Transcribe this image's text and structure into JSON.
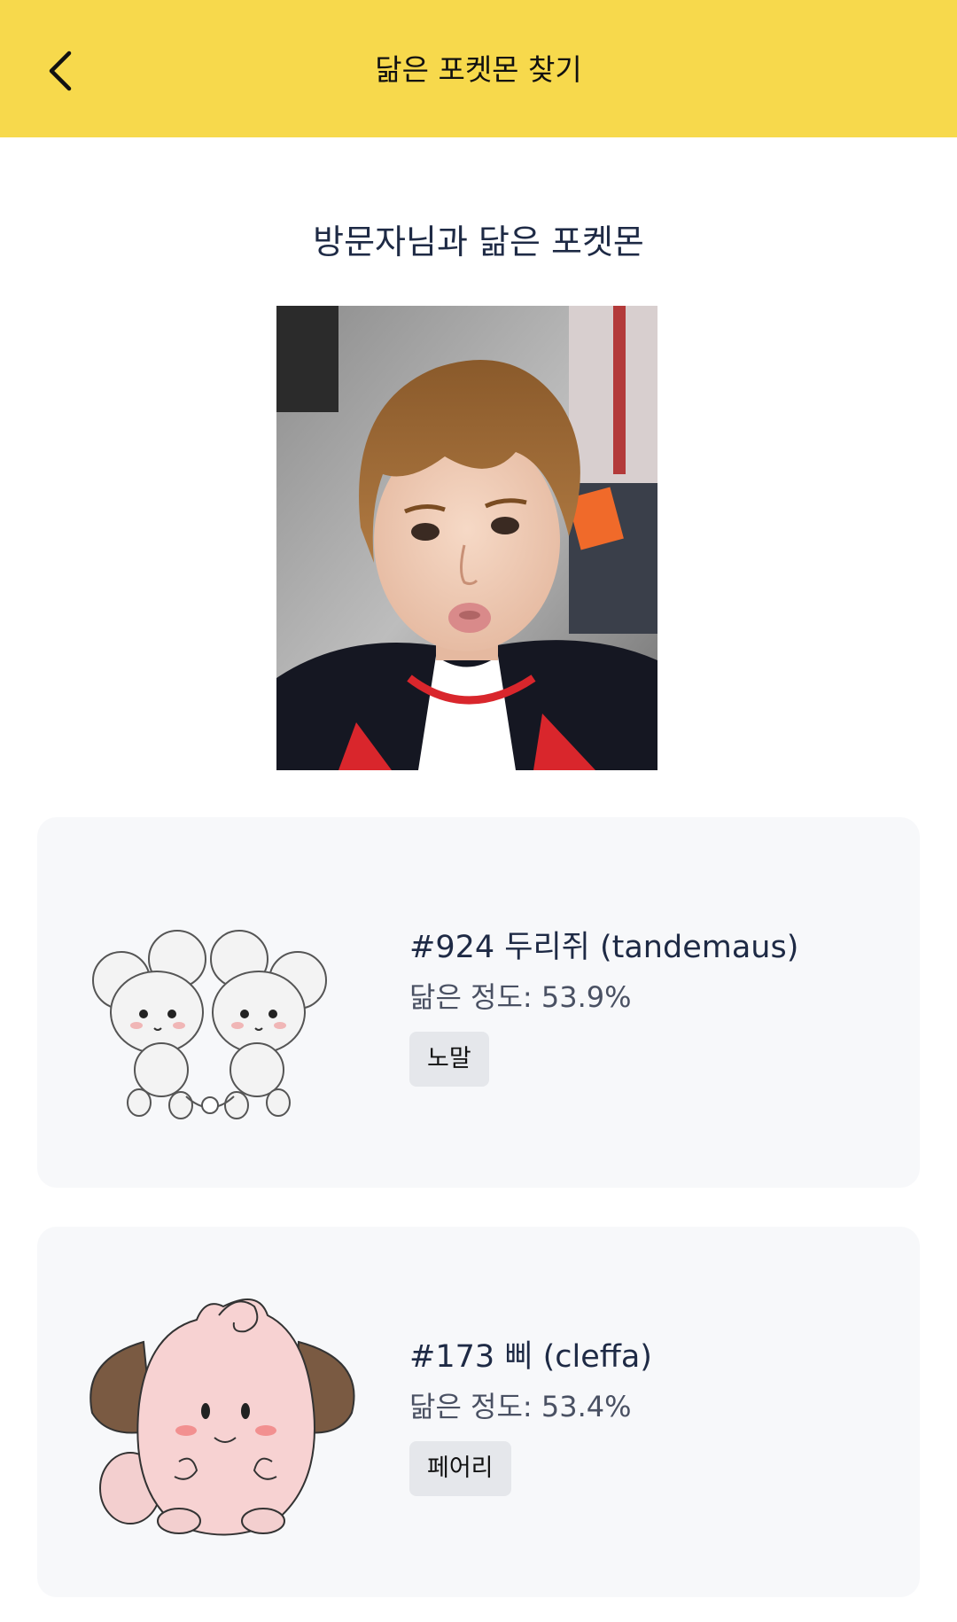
{
  "header": {
    "title": "닮은 포켓몬 찾기",
    "back_icon": "chevron-left-icon",
    "background": "#f7d94c"
  },
  "main": {
    "section_title": "방문자님과 닮은 포켓몬"
  },
  "results": [
    {
      "name": "#924 두리쥐 (tandemaus)",
      "similarity": "닮은 정도: 53.9%",
      "type": "노말",
      "similarity_value": 53.9
    },
    {
      "name": "#173 삐 (cleffa)",
      "similarity": "닮은 정도: 53.4%",
      "type": "페어리",
      "similarity_value": 53.4
    }
  ],
  "colors": {
    "accent": "#f7d94c",
    "card_bg": "#f7f8fa",
    "text": "#1e2a45",
    "badge_bg": "#e5e7eb"
  }
}
